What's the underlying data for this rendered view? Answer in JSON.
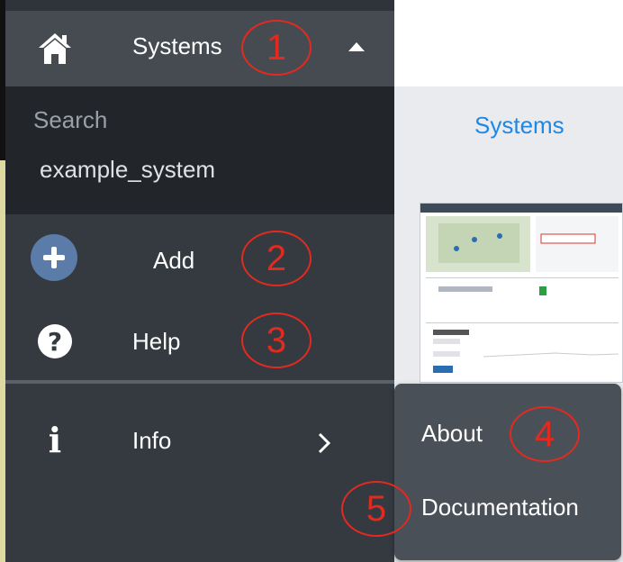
{
  "sidebar": {
    "systems": {
      "label": "Systems",
      "icon": "home-icon",
      "chevron": "chevron-up-icon"
    },
    "submenu": {
      "search_label": "Search",
      "items": [
        "example_system"
      ]
    },
    "add": {
      "label": "Add",
      "icon": "plus-circle-icon"
    },
    "help": {
      "label": "Help",
      "icon": "question-circle-icon",
      "glyph": "?"
    },
    "info": {
      "label": "Info",
      "icon": "info-icon",
      "glyph": "i",
      "chevron": "chevron-right-icon"
    }
  },
  "flyout": {
    "items": [
      "About",
      "Documentation"
    ]
  },
  "right_panel": {
    "title": "Systems"
  },
  "annotations": [
    "1",
    "2",
    "3",
    "4",
    "5"
  ],
  "colors": {
    "sidebar_bg": "#343a40",
    "active_row_bg": "#454b51",
    "submenu_bg": "#22262b",
    "add_circle": "#5b7ba8",
    "annotation_red": "#e32a1f",
    "link_blue": "#1e88e5",
    "flyout_bg": "#4a5057"
  }
}
